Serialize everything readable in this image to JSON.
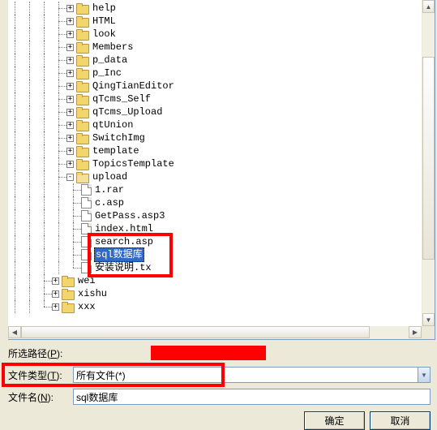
{
  "tree": {
    "folders_level2": [
      "help",
      "HTML",
      "look",
      "Members",
      "p_data",
      "p_Inc",
      "QingTianEditor",
      "qTcms_Self",
      "qTcms_Upload",
      "qtUnion",
      "SwitchImg",
      "template",
      "TopicsTemplate",
      "upload"
    ],
    "files_under_upload": [
      "1.rar",
      "c.asp",
      "GetPass.asp3",
      "index.html",
      "search.asp",
      "sql数据库",
      "安装说明.tx"
    ],
    "folders_level1_bottom": [
      "wei",
      "xishu",
      "xxx"
    ],
    "expander_plus": "+",
    "expander_minus": "-",
    "selected_item": "sql数据库"
  },
  "form": {
    "path_label_pre": "所选路径(",
    "path_label_hotkey": "P",
    "path_label_post": "):",
    "type_label_pre": "文件类型(",
    "type_label_hotkey": "T",
    "type_label_post": "):",
    "name_label_pre": "文件名(",
    "name_label_hotkey": "N",
    "name_label_post": "):",
    "type_value": "所有文件(*)",
    "name_value": "sql数据库",
    "ok_btn": "确定",
    "cancel_btn": "取消"
  },
  "scroll": {
    "up": "▲",
    "down": "▼",
    "left": "◀",
    "right": "▶"
  }
}
